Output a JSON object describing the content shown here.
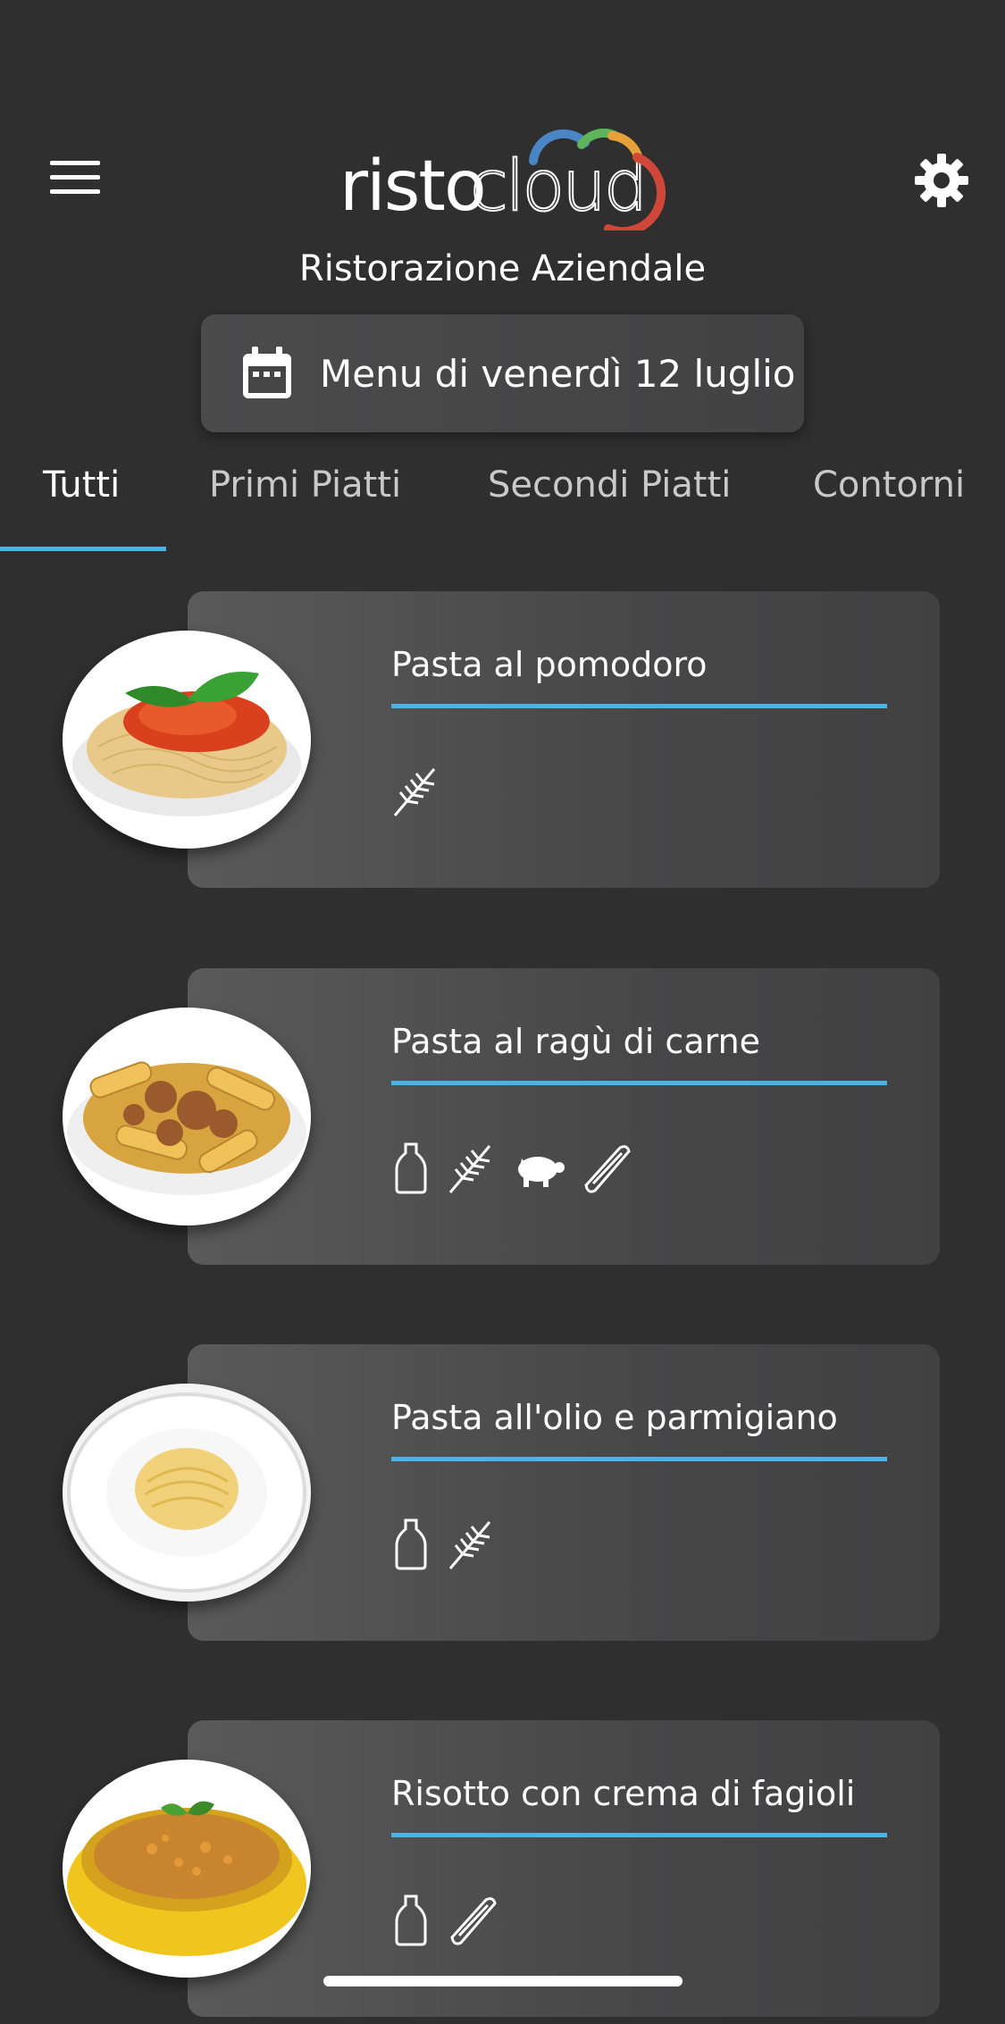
{
  "app": {
    "logo_a": "risto",
    "logo_b": "cloud",
    "subtitle": "Ristorazione Aziendale",
    "date_label": "Menu di venerdì 12 luglio"
  },
  "tabs": [
    {
      "label": "Tutti",
      "active": true
    },
    {
      "label": "Primi Piatti",
      "active": false
    },
    {
      "label": "Secondi Piatti",
      "active": false
    },
    {
      "label": "Contorni",
      "active": false
    }
  ],
  "dishes": [
    {
      "name": "Pasta al pomodoro",
      "icons": [
        "wheat-icon"
      ]
    },
    {
      "name": "Pasta al ragù di carne",
      "icons": [
        "milk-bottle-icon",
        "wheat-icon",
        "pig-icon",
        "celery-icon"
      ]
    },
    {
      "name": "Pasta all'olio e parmigiano",
      "icons": [
        "milk-bottle-icon",
        "wheat-icon"
      ]
    },
    {
      "name": "Risotto con crema di fagioli",
      "icons": [
        "milk-bottle-icon",
        "celery-icon"
      ]
    }
  ],
  "colors": {
    "background": "#2f2f30",
    "accent": "#4bb4e6",
    "card": "#4a4a4b"
  }
}
